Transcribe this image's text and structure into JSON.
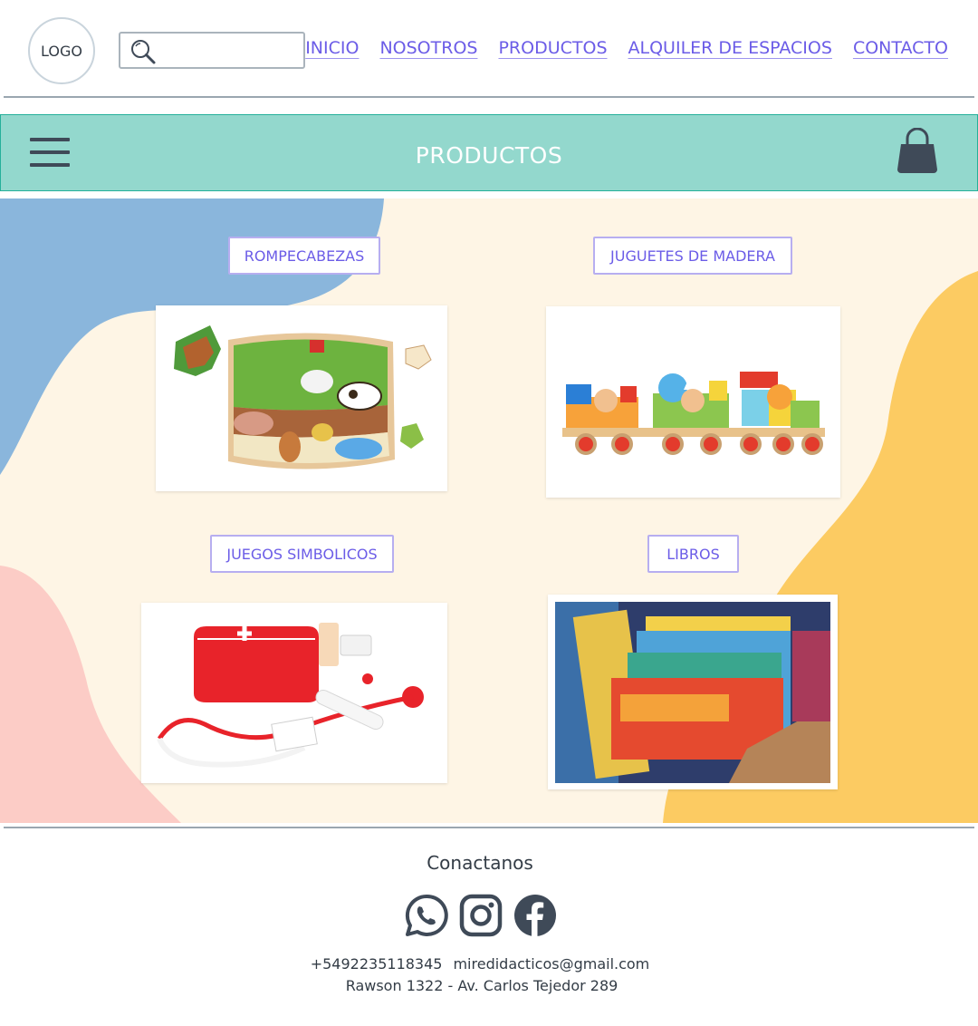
{
  "header": {
    "logo_text": "LOGO",
    "search_placeholder": "",
    "nav": [
      "INICIO",
      "NOSOTROS",
      "PRODUCTOS",
      "ALQUILER DE ESPACIOS",
      "CONTACTO"
    ]
  },
  "band": {
    "title": "PRODUCTOS"
  },
  "categories": [
    {
      "label": "ROMPECABEZAS",
      "image": "wooden-farm-animal-puzzle"
    },
    {
      "label": "JUGUETES DE MADERA",
      "image": "wooden-toy-train"
    },
    {
      "label": "JUEGOS SIMBOLICOS",
      "image": "toy-doctor-kit"
    },
    {
      "label": "LIBROS",
      "image": "childrens-books-crate"
    }
  ],
  "footer": {
    "title": "Conactanos",
    "social_icons": [
      "whatsapp-icon",
      "instagram-icon",
      "facebook-icon"
    ],
    "phone": "+5492235118345",
    "email": "miredidacticos@gmail.com",
    "address": "Rawson 1322 - Av. Carlos Tejedor 289"
  },
  "colors": {
    "band": "#93d8cd",
    "link": "#6b5ce7",
    "background_cream": "#fef5e5",
    "blob_blue": "#8ab6dc",
    "blob_yellow": "#fccb62",
    "blob_pink": "#fcccc6",
    "icons": "#3f4a58"
  }
}
